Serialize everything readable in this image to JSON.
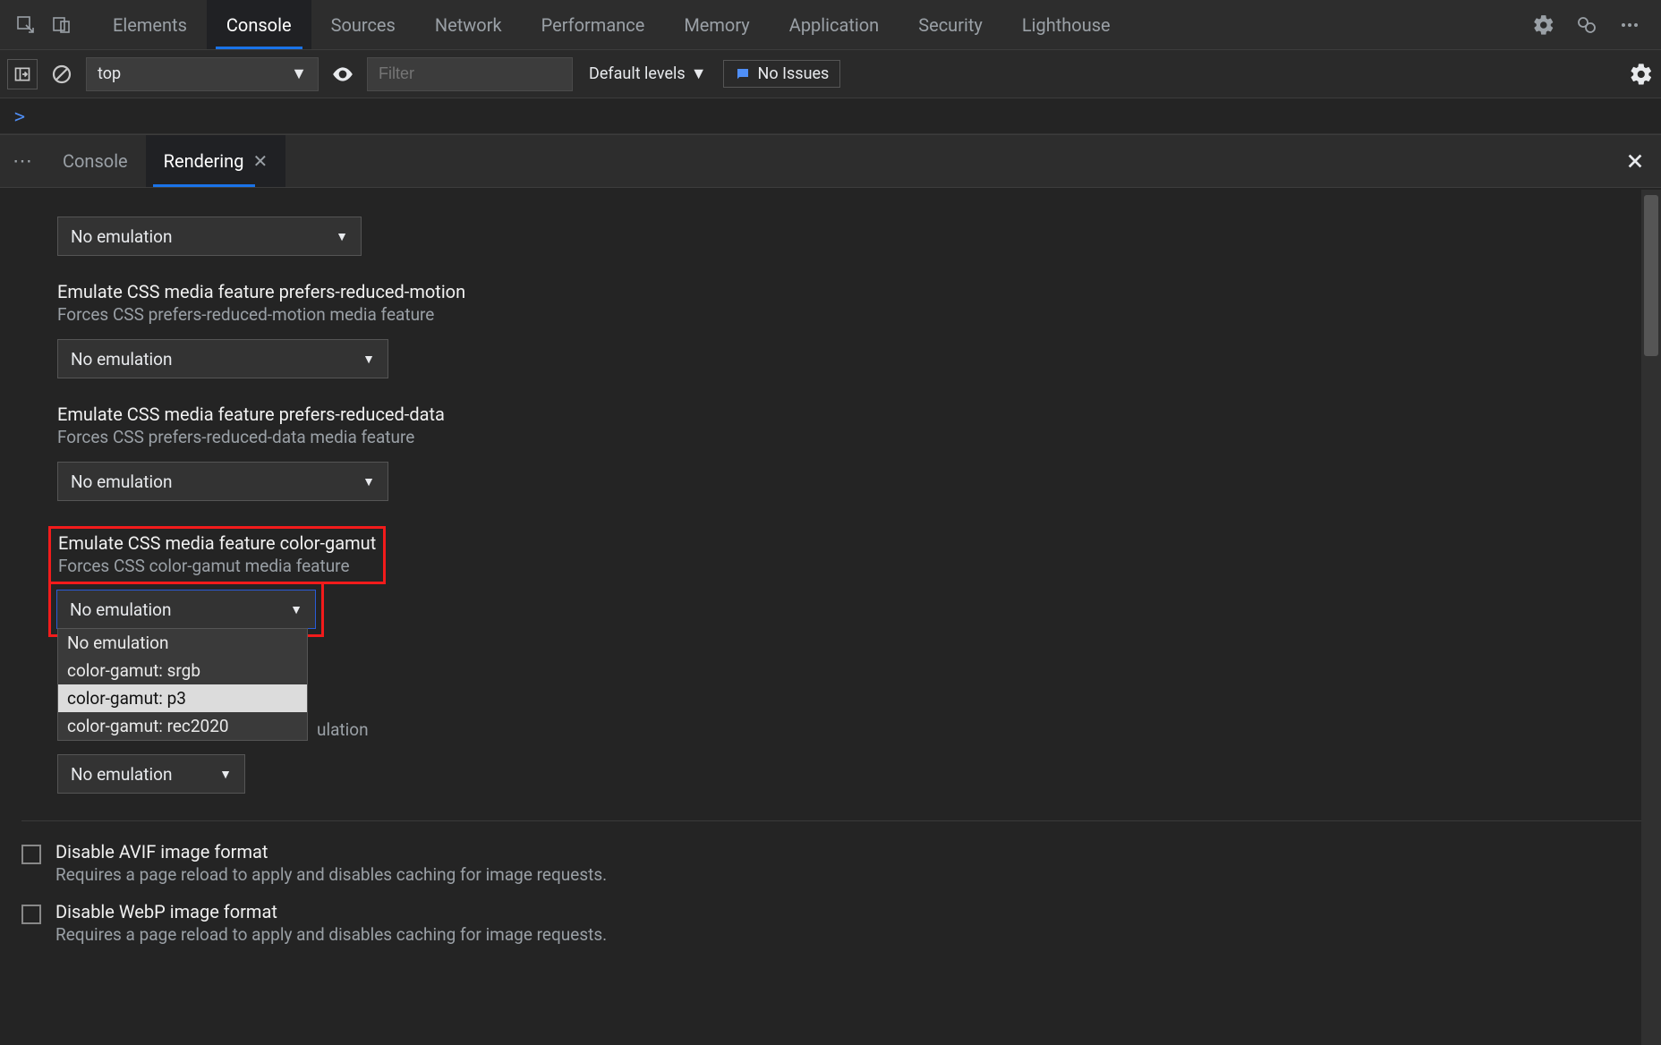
{
  "toolbar": {
    "tabs": [
      "Elements",
      "Console",
      "Sources",
      "Network",
      "Performance",
      "Memory",
      "Application",
      "Security",
      "Lighthouse"
    ],
    "active_tab": "Console"
  },
  "filterbar": {
    "context": "top",
    "filter_placeholder": "Filter",
    "levels_label": "Default levels",
    "issues_label": "No Issues"
  },
  "prompt": ">",
  "drawer": {
    "tabs": [
      {
        "label": "Console",
        "active": false,
        "closable": false
      },
      {
        "label": "Rendering",
        "active": true,
        "closable": true
      }
    ]
  },
  "rendering": {
    "sections": [
      {
        "id": "top",
        "select_value": "No emulation"
      },
      {
        "id": "reduced-motion",
        "title": "Emulate CSS media feature prefers-reduced-motion",
        "desc": "Forces CSS prefers-reduced-motion media feature",
        "select_value": "No emulation"
      },
      {
        "id": "reduced-data",
        "title": "Emulate CSS media feature prefers-reduced-data",
        "desc": "Forces CSS prefers-reduced-data media feature",
        "select_value": "No emulation"
      },
      {
        "id": "color-gamut",
        "title": "Emulate CSS media feature color-gamut",
        "desc": "Forces CSS color-gamut media feature",
        "select_value": "No emulation",
        "options": [
          "No emulation",
          "color-gamut: srgb",
          "color-gamut: p3",
          "color-gamut: rec2020"
        ],
        "hover_option": "color-gamut: p3"
      },
      {
        "id": "peek",
        "peek_text": "ulation",
        "select_value": "No emulation"
      }
    ],
    "checkboxes": [
      {
        "id": "avif",
        "title": "Disable AVIF image format",
        "desc": "Requires a page reload to apply and disables caching for image requests."
      },
      {
        "id": "webp",
        "title": "Disable WebP image format",
        "desc": "Requires a page reload to apply and disables caching for image requests."
      }
    ]
  }
}
